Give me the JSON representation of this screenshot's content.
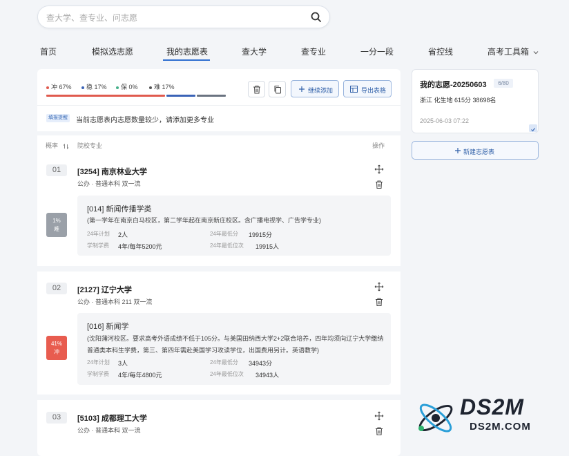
{
  "search": {
    "placeholder": "查大学、查专业、问志愿"
  },
  "nav": [
    {
      "label": "首页"
    },
    {
      "label": "模拟选志愿"
    },
    {
      "label": "我的志愿表"
    },
    {
      "label": "查大学"
    },
    {
      "label": "查专业"
    },
    {
      "label": "一分一段"
    },
    {
      "label": "省控线"
    },
    {
      "label": "高考工具箱"
    }
  ],
  "stats": [
    {
      "label": "冲 67%",
      "color": "#e05a4e"
    },
    {
      "label": "稳 17%",
      "color": "#3a63b7"
    },
    {
      "label": "保 0%",
      "color": "#46b08a"
    },
    {
      "label": "难 17%",
      "color": "#555555"
    }
  ],
  "toolbar": {
    "continue_add": "继续添加",
    "export_table": "导出表格"
  },
  "hint": {
    "tag": "填报提醒",
    "text": "当前志愿表内志愿数量较少，请添加更多专业"
  },
  "columns": {
    "prob": "概率",
    "school": "院校专业",
    "action": "操作"
  },
  "entries": [
    {
      "num": "01",
      "name": "[3254] 南京林业大学",
      "meta": "公办 · 普通本科 双一流",
      "badge_pct": "1%",
      "badge_label": "难",
      "badge_color": "#9aa0a8",
      "major": "[014] 新闻传播学类",
      "desc": "(第一学年在南京白马校区，第二学年起在南京新庄校区。含广播电视学、广告学专业)",
      "plan_label": "24年计划",
      "plan_value": "2人",
      "min_score_label": "24年最低分",
      "min_score_value": "19915分",
      "fee_label": "学制学费",
      "fee_value": "4年/每年5200元",
      "min_rank_label": "24年最低位次",
      "min_rank_value": "19915人"
    },
    {
      "num": "02",
      "name": "[2127] 辽宁大学",
      "meta": "公办 · 普通本科 211 双一流",
      "badge_pct": "41%",
      "badge_label": "冲",
      "badge_color": "#e85c4f",
      "major": "[016] 新闻学",
      "desc": "(沈阳蒲河校区。要求高考外语成绩不低于105分。与美国田纳西大学2+2联合培养，四年均须向辽宁大学缴纳普通类本科生学费，第三、第四年需赴美国学习攻读学位，出国费用另计。英语教学)",
      "plan_label": "24年计划",
      "plan_value": "3人",
      "min_score_label": "24年最低分",
      "min_score_value": "34943分",
      "fee_label": "学制学费",
      "fee_value": "4年/每年4800元",
      "min_rank_label": "24年最低位次",
      "min_rank_value": "34943人"
    },
    {
      "num": "03",
      "name": "[5103] 成都理工大学",
      "meta": "公办 · 普通本科 双一流"
    }
  ],
  "plan": {
    "title": "我的志愿-20250603",
    "count": "6/80",
    "info": "浙江 化生地 615分 38698名",
    "date": "2025-06-03 07:22",
    "new_button": "新建志愿表"
  },
  "watermark": {
    "text": "DS2M",
    "url": "DS2M.COM"
  }
}
